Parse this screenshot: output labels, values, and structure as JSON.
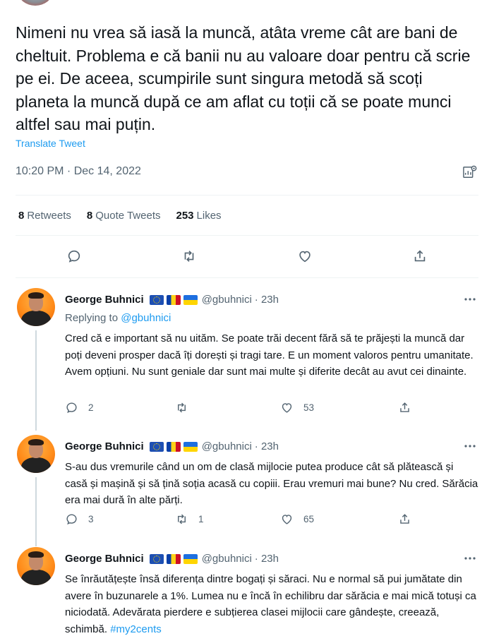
{
  "main_tweet": {
    "text": "Nimeni nu vrea să iasă la muncă, atâta vreme cât are bani de cheltuit. Problema e că banii nu au valoare doar pentru că scrie pe ei. De aceea, scumpirile sunt singura metodă să scoți planeta la muncă după ce am aflat cu toții că se poate munci altfel sau mai puțin.",
    "translate_label": "Translate Tweet",
    "timestamp": "10:20 PM · Dec 14, 2022",
    "stats": {
      "retweets_count": "8",
      "retweets_label": "Retweets",
      "quotes_count": "8",
      "quotes_label": "Quote Tweets",
      "likes_count": "253",
      "likes_label": "Likes"
    },
    "actions": [
      "reply-icon",
      "retweet-icon",
      "like-icon",
      "share-icon"
    ]
  },
  "replies": [
    {
      "author": "George Buhnici",
      "flags": [
        "eu-flag",
        "romania-flag",
        "ukraine-flag"
      ],
      "handle": "@gbuhnici",
      "time": "· 23h",
      "replying_prefix": "Replying to",
      "replying_to": "@gbuhnici",
      "text": "Cred că e important să nu uităm. Se poate trăi decent fără să te prăjești la muncă dar poți deveni prosper dacă îți dorești și tragi tare. E un moment valoros pentru umanitate. Avem opțiuni. Nu sunt geniale dar sunt mai multe și diferite decât au avut cei dinainte.",
      "hashtag": "",
      "reply_count": "2",
      "retweet_count": "",
      "like_count": "53"
    },
    {
      "author": "George Buhnici",
      "flags": [
        "eu-flag",
        "romania-flag",
        "ukraine-flag"
      ],
      "handle": "@gbuhnici",
      "time": "· 23h",
      "text": "S-au dus vremurile când un om de clasă mijlocie putea produce cât să plătească și casă și mașină și să țină soția acasă cu copiii. Erau vremuri mai bune? Nu cred. Sărăcia era mai dură în alte părți.",
      "hashtag": "",
      "reply_count": "3",
      "retweet_count": "1",
      "like_count": "65"
    },
    {
      "author": "George Buhnici",
      "flags": [
        "eu-flag",
        "romania-flag",
        "ukraine-flag"
      ],
      "handle": "@gbuhnici",
      "time": "· 23h",
      "text": "Se înrăutățește însă diferența dintre bogați și săraci. Nu e normal să pui jumătate din avere în buzunarele a 1%. Lumea nu e încă în echilibru dar sărăcia e mai mică totuși ca niciodată. Adevărata pierdere e subțierea clasei mijlocii care gândește, creează, schimbă.",
      "hashtag": "#my2cents"
    }
  ],
  "colors": {
    "text": "#0f1419",
    "secondary": "#536471",
    "link": "#1d9bf0",
    "divider": "#eff3f4"
  }
}
